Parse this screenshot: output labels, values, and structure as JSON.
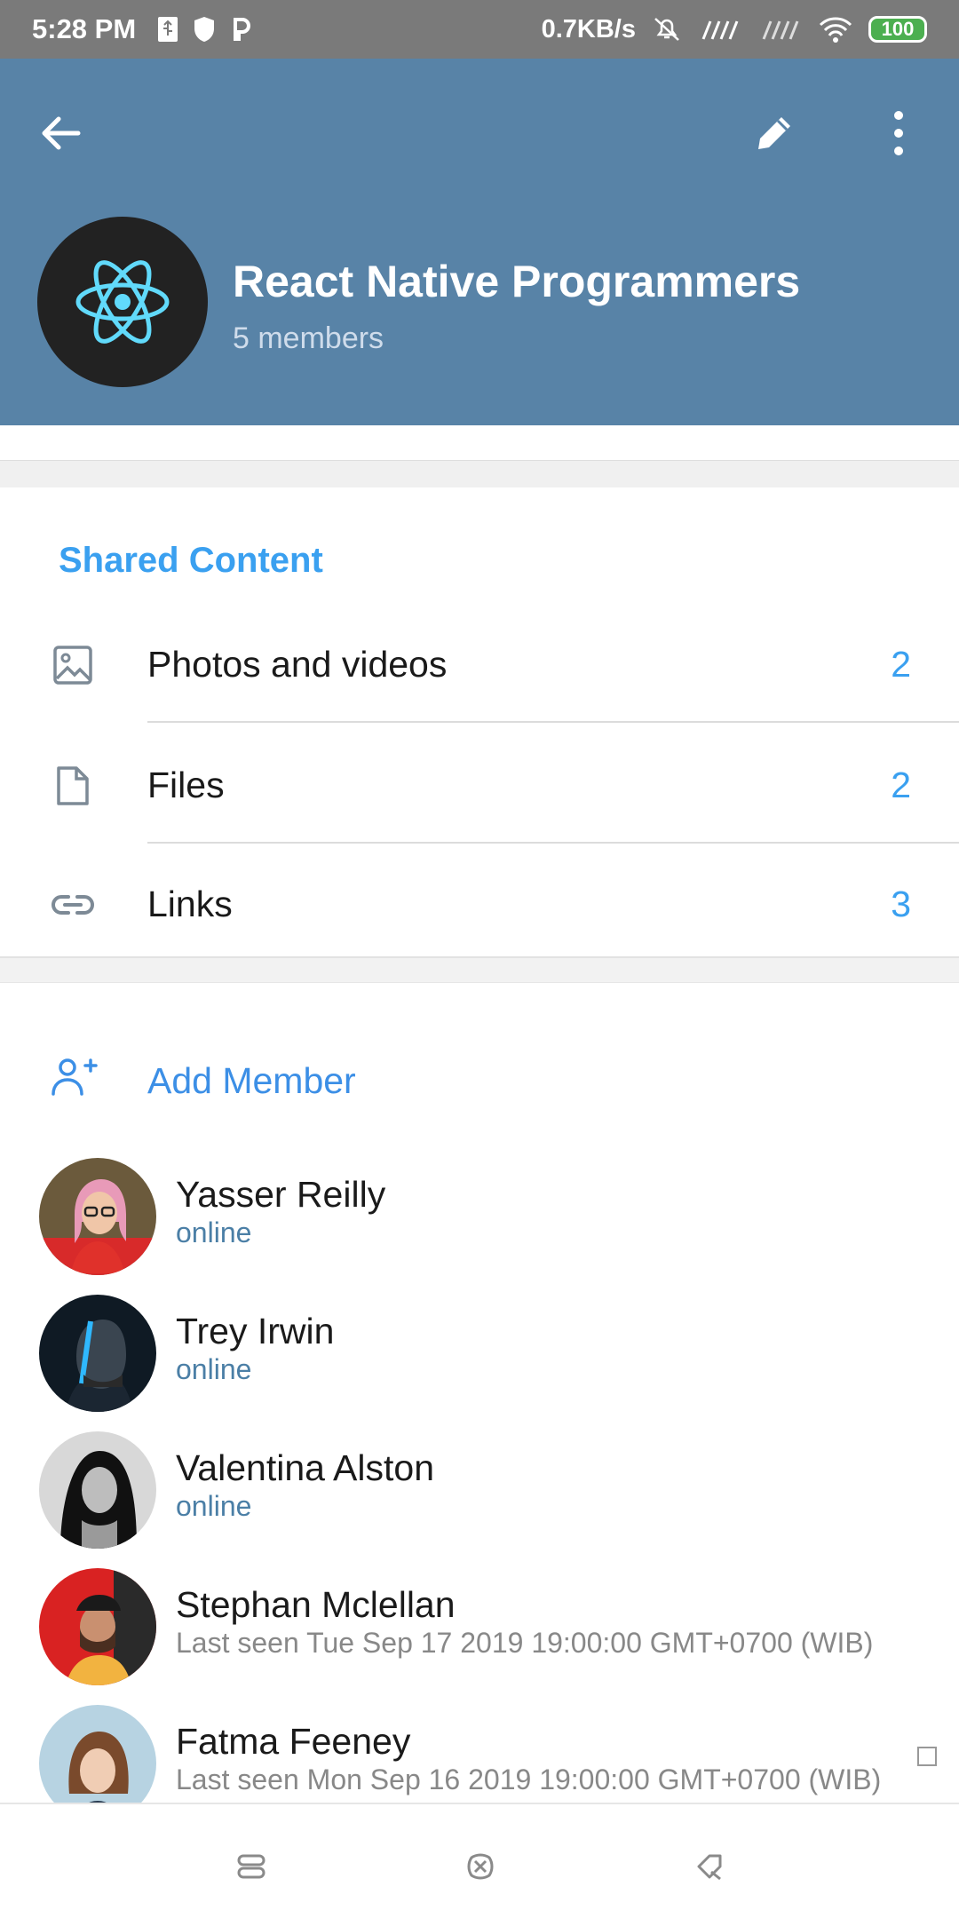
{
  "status_bar": {
    "time": "5:28 PM",
    "speed": "0.7KB/s",
    "battery": "100",
    "icons": [
      "usb-icon",
      "shield-icon",
      "p-icon",
      "mute-icon",
      "signal-icon",
      "signal-icon",
      "wifi-icon",
      "battery-icon"
    ]
  },
  "header": {
    "title": "React Native Programmers",
    "subtitle": "5 members",
    "avatar_icon": "react-logo-icon",
    "background_color": "#5883a7"
  },
  "shared": {
    "title": "Shared Content",
    "rows": [
      {
        "label": "Photos and videos",
        "count": "2",
        "icon": "photo-icon"
      },
      {
        "label": "Files",
        "count": "2",
        "icon": "file-icon"
      },
      {
        "label": "Links",
        "count": "3",
        "icon": "link-icon"
      }
    ]
  },
  "members": {
    "add_label": "Add Member",
    "list": [
      {
        "name": "Yasser Reilly",
        "status": "online"
      },
      {
        "name": "Trey Irwin",
        "status": "online"
      },
      {
        "name": "Valentina Alston",
        "status": "online"
      },
      {
        "name": "Stephan Mclellan",
        "status": "Last seen Tue Sep 17 2019 19:00:00 GMT+0700 (WIB)"
      },
      {
        "name": "Fatma Feeney",
        "status": "Last seen Mon Sep 16 2019 19:00:00 GMT+0700 (WIB)"
      }
    ]
  },
  "colors": {
    "accent": "#3aa0f0",
    "online": "#4b7fa6"
  }
}
